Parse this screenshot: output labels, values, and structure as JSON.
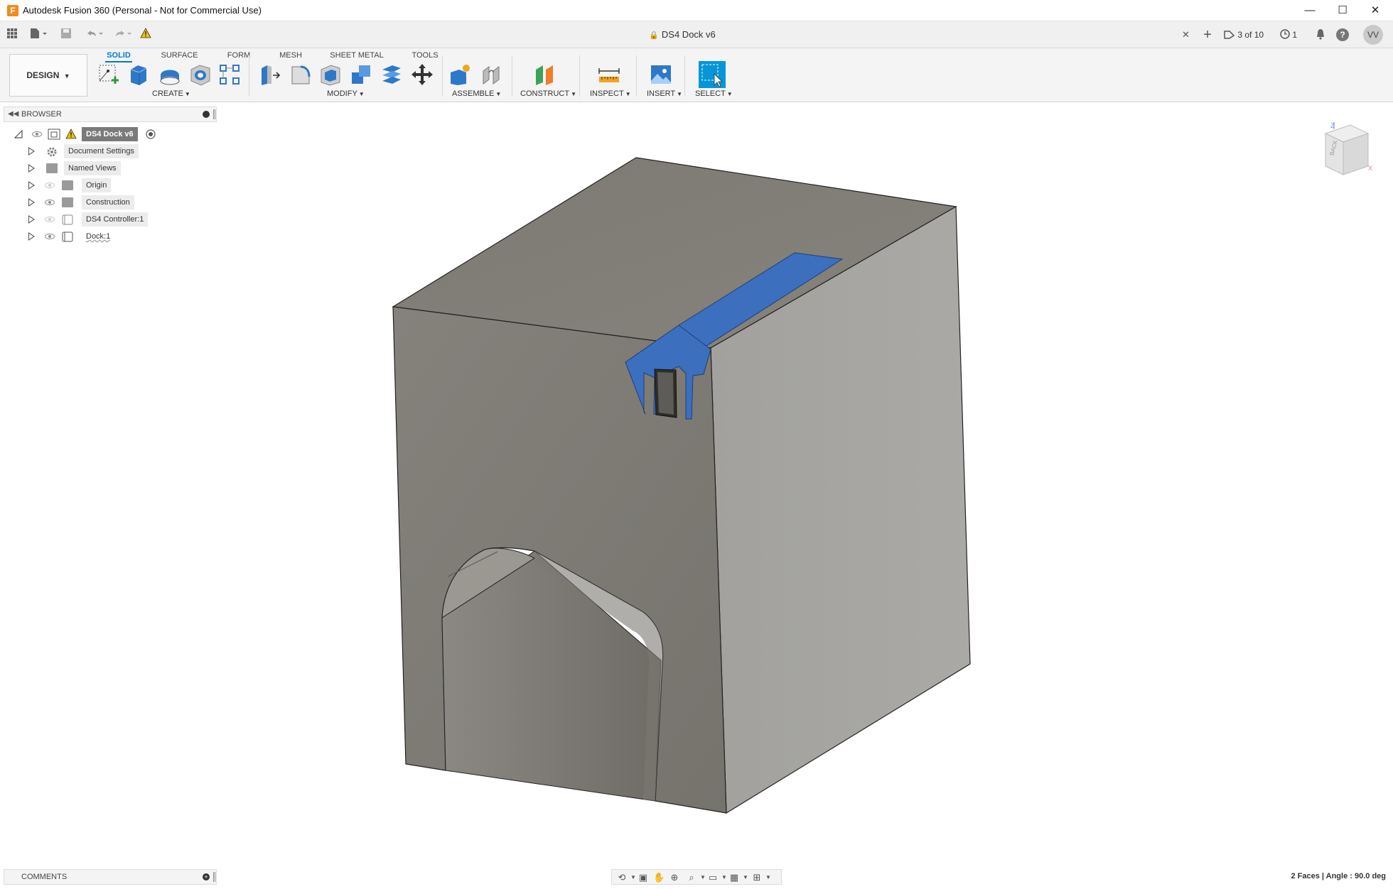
{
  "window": {
    "title": "Autodesk Fusion 360 (Personal - Not for Commercial Use)",
    "app_icon_letter": "F",
    "minimize_glyph": "—",
    "maximize_glyph": "☐",
    "close_glyph": "✕"
  },
  "tabbar": {
    "document_title": "DS4 Dock v6",
    "close_glyph": "✕",
    "new_tab_glyph": "+",
    "jobs_label": "3 of 10",
    "clock_count": "1",
    "help_glyph": "?",
    "user_initials": "VV"
  },
  "toolbar": {
    "workspace_label": "DESIGN",
    "tabs": [
      "SOLID",
      "SURFACE",
      "FORM",
      "MESH",
      "SHEET METAL",
      "TOOLS"
    ],
    "active_tab": "SOLID",
    "groups": {
      "create": "CREATE",
      "modify": "MODIFY",
      "assemble": "ASSEMBLE",
      "construct": "CONSTRUCT",
      "inspect": "INSPECT",
      "insert": "INSERT",
      "select": "SELECT"
    },
    "accent_color": "#0696d7"
  },
  "browser": {
    "title": "BROWSER",
    "root": "DS4 Dock v6",
    "items": [
      {
        "label": "Document Settings"
      },
      {
        "label": "Named Views"
      },
      {
        "label": "Origin"
      },
      {
        "label": "Construction"
      },
      {
        "label": "DS4 Controller:1"
      },
      {
        "label": "Dock:1"
      }
    ]
  },
  "comments": {
    "title": "COMMENTS"
  },
  "status": {
    "text": "2 Faces | Angle : 90.0 deg"
  },
  "viewcube": {
    "face_label": "BACK",
    "axis_z": "Z",
    "axis_x": "X"
  },
  "colors": {
    "selection_blue": "#3d6fbf",
    "body_front": "#817e78",
    "body_side": "#a7a6a2",
    "body_top": "#7f7c75"
  }
}
